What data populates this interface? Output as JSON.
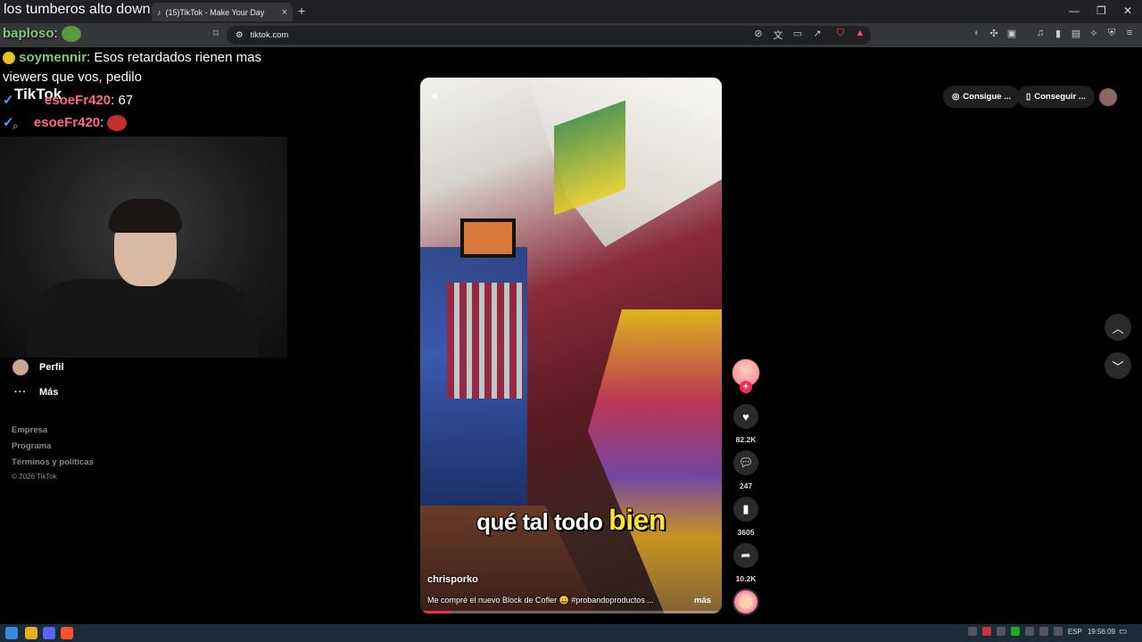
{
  "overlay": {
    "window_title": "los tumberos alto down",
    "chat": [
      {
        "user": "baploso",
        "text": ""
      },
      {
        "user": "soymennir",
        "text": "Esos retardados rienen mas"
      },
      {
        "user": "",
        "text": "viewers que vos, pedilo"
      },
      {
        "user": "esoeFr420",
        "text": "67"
      },
      {
        "user": "esoeFr420",
        "text": ""
      }
    ],
    "tiktok_logo_text": "TikTok"
  },
  "browser": {
    "tab_title": "(15)TikTok - Make Your Day",
    "url": "tiktok.com",
    "tab_close": "×",
    "new_tab": "+"
  },
  "sidebar": {
    "perfil": "Perfil",
    "mas": "Más",
    "footer": [
      "Empresa",
      "Programa",
      "Términos y políticas",
      "© 2026 TikTok"
    ]
  },
  "video": {
    "caption_prefix": "qué tal todo",
    "caption_highlight": "bien",
    "author": "chrisporko",
    "description": "Me compré el nuevo Block de Cofler 😀 #probandoproductos ...",
    "more_label": "más",
    "progress": 0.1
  },
  "actions": {
    "likes": "82.2K",
    "comments": "247",
    "saves": "3605",
    "shares": "10.2K"
  },
  "header": {
    "pill1": "Consigue ...",
    "pill2": "Conseguir ..."
  },
  "taskbar": {
    "lang": "ESP",
    "time": "19:56:09"
  },
  "colors": {
    "accent": "#fe2c55",
    "caption_highlight": "#ffe23a"
  }
}
